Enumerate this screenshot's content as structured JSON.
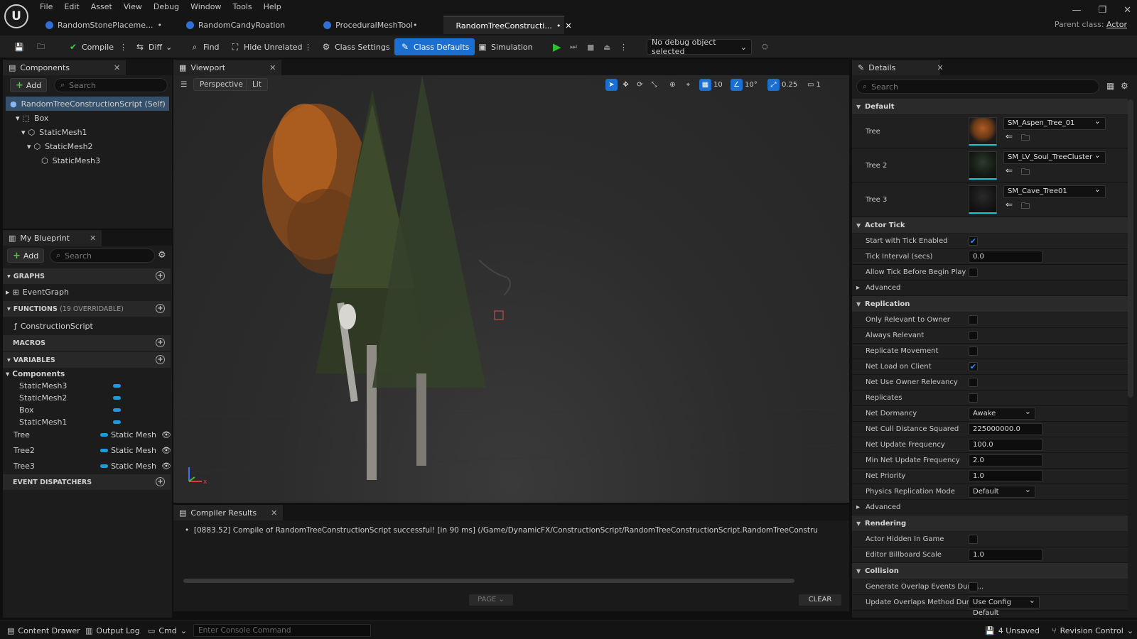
{
  "app": {
    "logo_text": "U",
    "menu": [
      "File",
      "Edit",
      "Asset",
      "View",
      "Debug",
      "Window",
      "Tools",
      "Help"
    ],
    "tabs": [
      {
        "label": "RandomStonePlaceme...",
        "dirty": "•"
      },
      {
        "label": "RandomCandyRoation",
        "dirty": ""
      },
      {
        "label": "ProceduralMeshTool•",
        "dirty": ""
      },
      {
        "label": "RandomTreeConstructi...",
        "dirty": "•"
      }
    ],
    "parent_class_label": "Parent class:",
    "parent_class_value": "Actor"
  },
  "toolbar": {
    "compile": "Compile",
    "diff": "Diff",
    "find": "Find",
    "hide_unrelated": "Hide Unrelated",
    "class_settings": "Class Settings",
    "class_defaults": "Class Defaults",
    "simulation": "Simulation",
    "debug_object": "No debug object selected"
  },
  "components": {
    "title": "Components",
    "add": "Add",
    "search_placeholder": "Search",
    "items": [
      "RandomTreeConstructionScript (Self)",
      "Box",
      "StaticMesh1",
      "StaticMesh2",
      "StaticMesh3"
    ]
  },
  "my_blueprint": {
    "title": "My Blueprint",
    "add": "Add",
    "search_placeholder": "Search",
    "graphs": "GRAPHS",
    "event_graph": "EventGraph",
    "functions": "FUNCTIONS",
    "functions_sub": "(19 OVERRIDABLE)",
    "construction_script": "ConstructionScript",
    "macros": "MACROS",
    "variables": "VARIABLES",
    "components_cat": "Components",
    "component_vars": [
      "StaticMesh3",
      "StaticMesh2",
      "Box",
      "StaticMesh1"
    ],
    "mesh_vars": [
      {
        "name": "Tree",
        "type": "Static Mesh"
      },
      {
        "name": "Tree2",
        "type": "Static Mesh"
      },
      {
        "name": "Tree3",
        "type": "Static Mesh"
      }
    ],
    "event_dispatchers": "EVENT DISPATCHERS"
  },
  "viewport": {
    "title": "Viewport",
    "perspective": "Perspective",
    "lit": "Lit",
    "grid_size": "10",
    "rotation_snap": "10°",
    "scale_snap": "0.25",
    "camera_speed": "1",
    "axis_x": "x"
  },
  "compiler": {
    "title": "Compiler Results",
    "message": "[0883.52] Compile of RandomTreeConstructionScript successful! [in 90 ms] (/Game/DynamicFX/ConstructionScript/RandomTreeConstructionScript.RandomTreeConstru",
    "page": "PAGE",
    "clear": "CLEAR"
  },
  "details": {
    "title": "Details",
    "search_placeholder": "Search",
    "default_section": "Default",
    "trees": [
      {
        "label": "Tree",
        "asset": "SM_Aspen_Tree_01"
      },
      {
        "label": "Tree 2",
        "asset": "SM_LV_Soul_TreeCluster"
      },
      {
        "label": "Tree 3",
        "asset": "SM_Cave_Tree01"
      }
    ],
    "actor_tick": "Actor Tick",
    "start_tick": "Start with Tick Enabled",
    "tick_interval": "Tick Interval (secs)",
    "tick_interval_val": "0.0",
    "allow_tick": "Allow Tick Before Begin Play",
    "advanced": "Advanced",
    "replication": "Replication",
    "only_relevant": "Only Relevant to Owner",
    "always_relevant": "Always Relevant",
    "replicate_movement": "Replicate Movement",
    "net_load": "Net Load on Client",
    "net_owner": "Net Use Owner Relevancy",
    "replicates": "Replicates",
    "net_dormancy": "Net Dormancy",
    "net_dormancy_val": "Awake",
    "net_cull": "Net Cull Distance Squared",
    "net_cull_val": "225000000.0",
    "net_update": "Net Update Frequency",
    "net_update_val": "100.0",
    "min_net_update": "Min Net Update Frequency",
    "min_net_update_val": "2.0",
    "net_priority": "Net Priority",
    "net_priority_val": "1.0",
    "physics_rep": "Physics Replication Mode",
    "physics_rep_val": "Default",
    "advanced2": "Advanced",
    "rendering": "Rendering",
    "hidden_in_game": "Actor Hidden In Game",
    "billboard": "Editor Billboard Scale",
    "billboard_val": "1.0",
    "collision": "Collision",
    "gen_overlap": "Generate Overlap Events Durin...",
    "update_overlap": "Update Overlaps Method Durin...",
    "update_overlap_val": "Use Config Default"
  },
  "statusbar": {
    "content_drawer": "Content Drawer",
    "output_log": "Output Log",
    "cmd": "Cmd",
    "console_placeholder": "Enter Console Command",
    "unsaved": "4 Unsaved",
    "revision": "Revision Control"
  }
}
